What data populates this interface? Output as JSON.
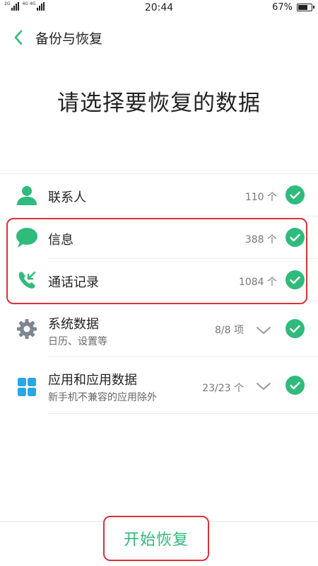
{
  "status_bar": {
    "network_1": "2G",
    "network_2": "4G 4G",
    "time": "20:44",
    "battery_percent": "67%",
    "battery_level": 0.67
  },
  "header": {
    "title": "备份与恢复"
  },
  "main": {
    "title": "请选择要恢复的数据"
  },
  "items": [
    {
      "label": "联系人",
      "count": "110 个",
      "checked": true
    },
    {
      "label": "信息",
      "count": "388 个",
      "checked": true
    },
    {
      "label": "通话记录",
      "count": "1084 个",
      "checked": true
    },
    {
      "label": "系统数据",
      "sublabel": "日历、设置等",
      "count": "8/8 项",
      "checked": true
    },
    {
      "label": "应用和应用数据",
      "sublabel": "新手机不兼容的应用除外",
      "count": "23/23 个",
      "checked": true
    }
  ],
  "start_button": {
    "label": "开始恢复"
  },
  "colors": {
    "accent_green": "#2fbb7b",
    "highlight_red": "#d8333b"
  }
}
